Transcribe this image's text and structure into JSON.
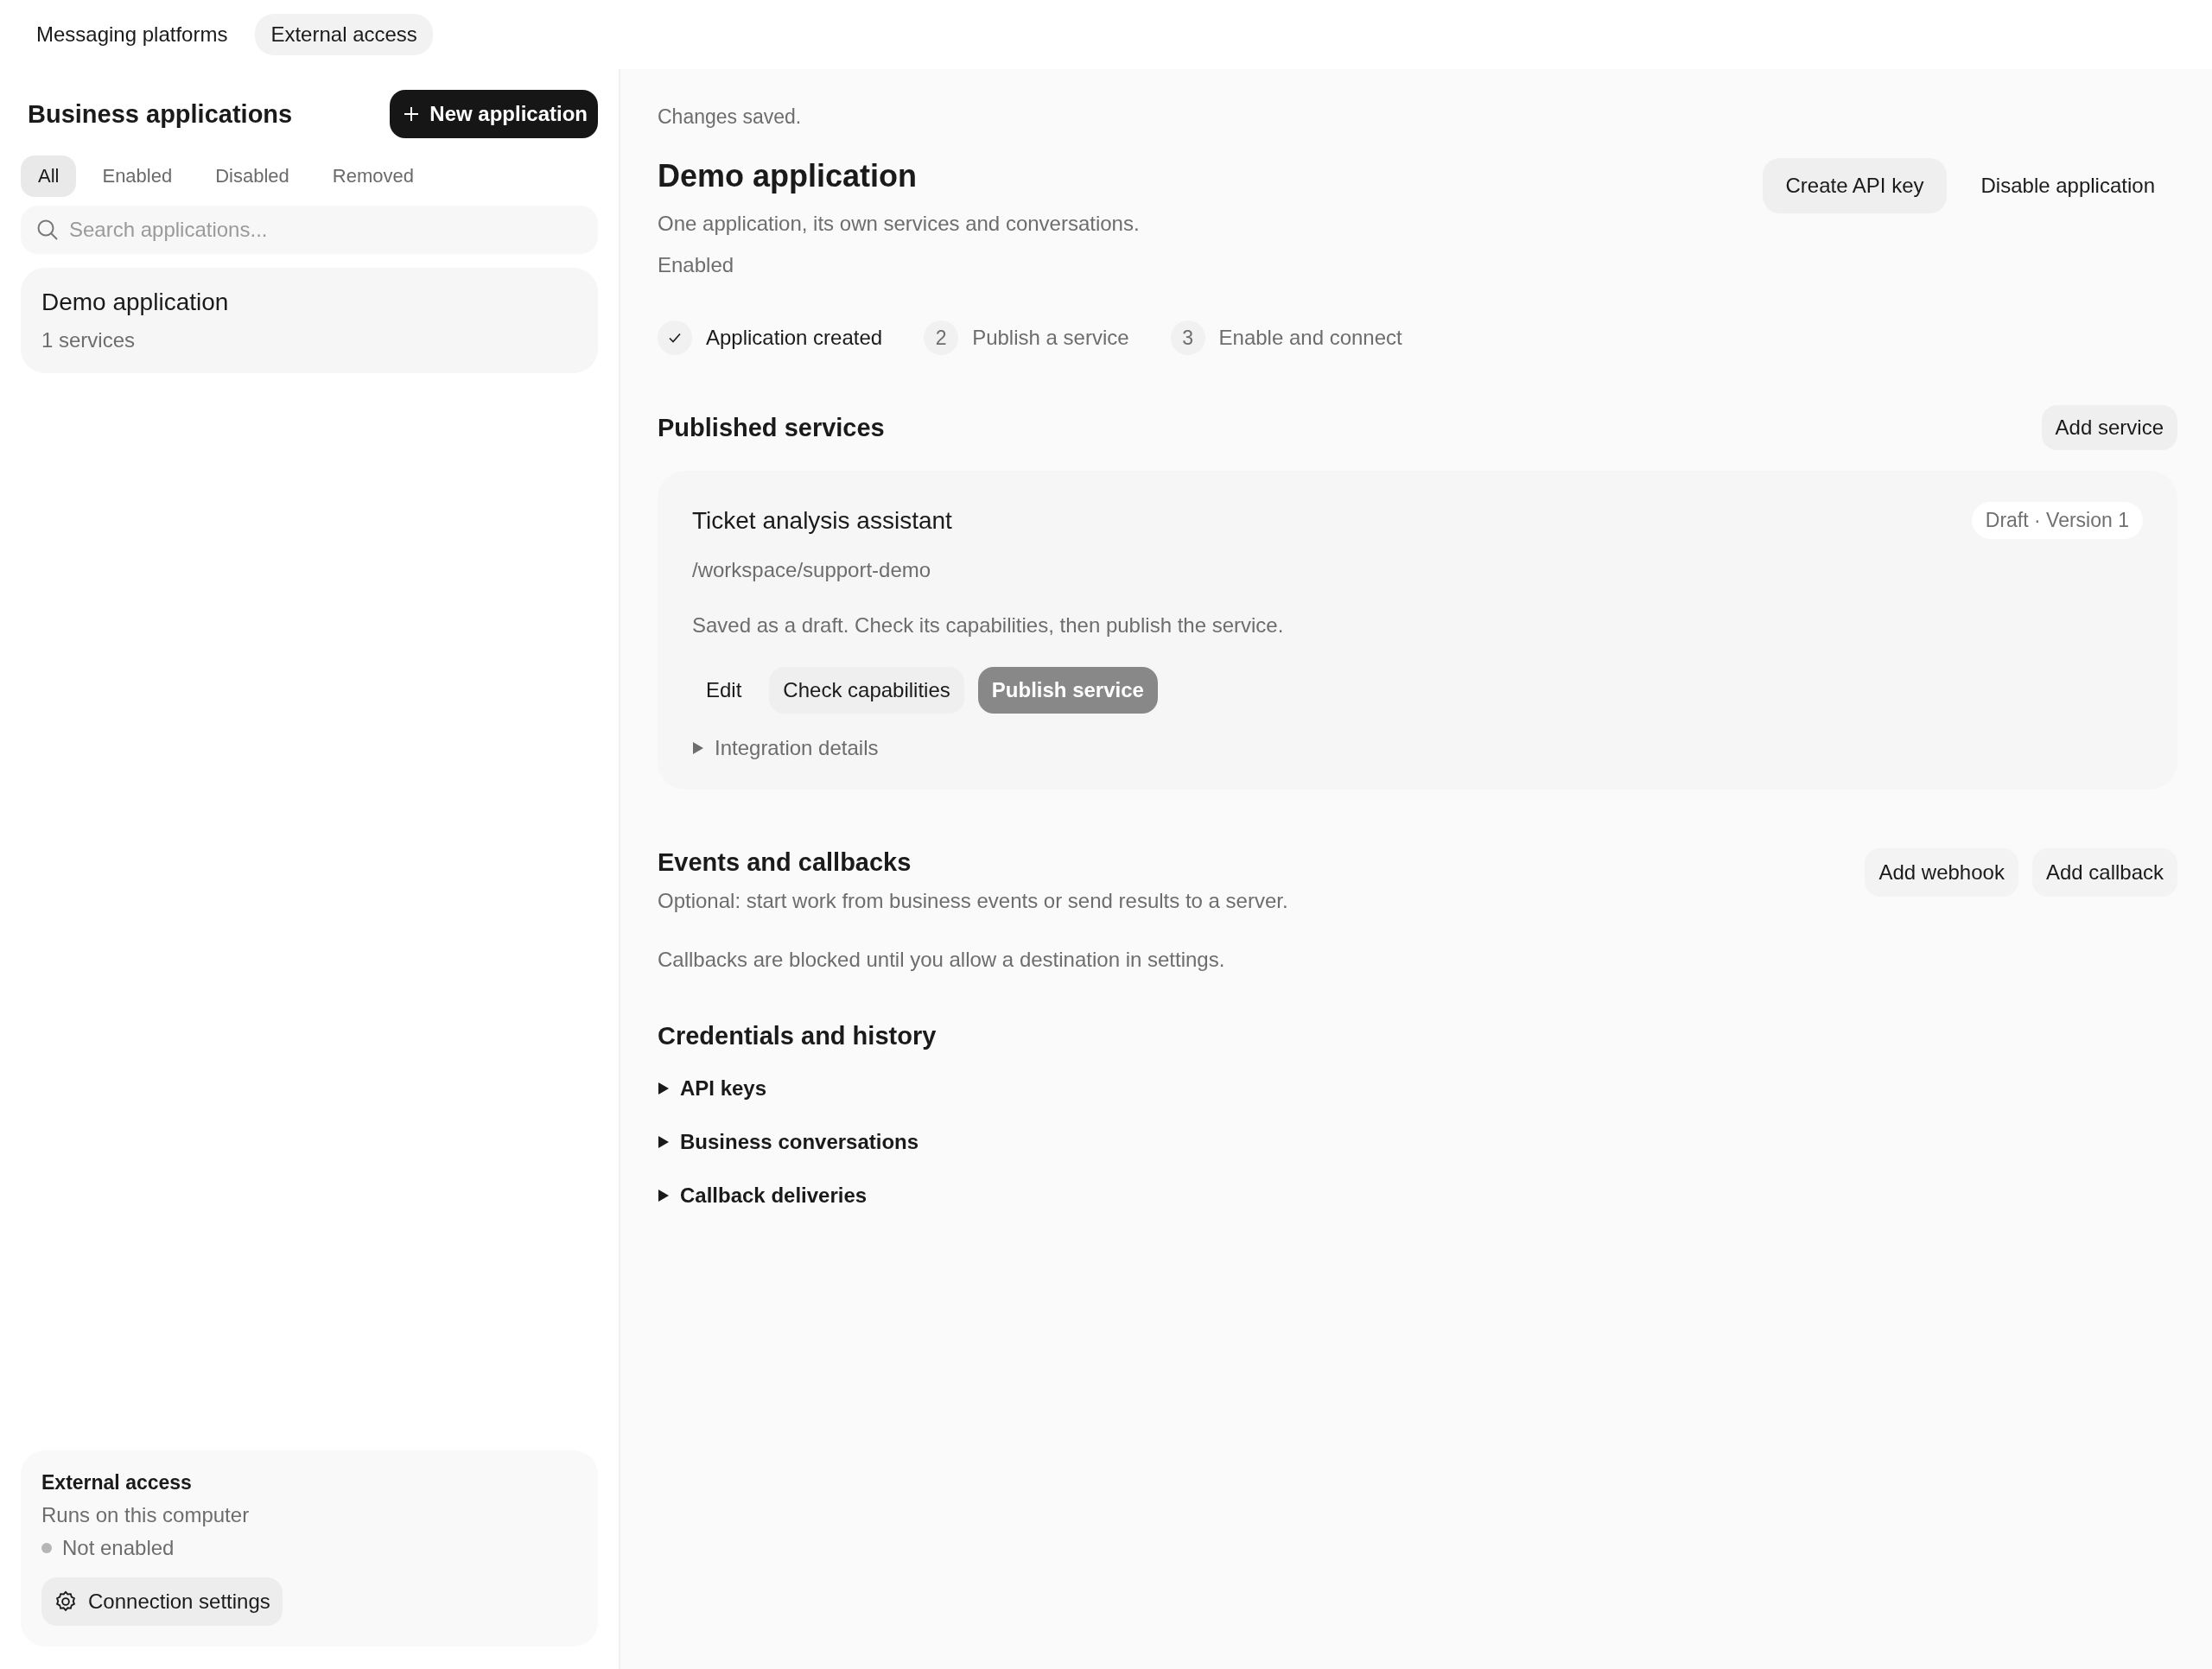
{
  "top_tabs": [
    {
      "label": "Messaging platforms",
      "selected": false
    },
    {
      "label": "External access",
      "selected": true
    }
  ],
  "sidebar": {
    "title": "Business applications",
    "new_button": "New application",
    "filters": [
      {
        "label": "All",
        "selected": true
      },
      {
        "label": "Enabled",
        "selected": false
      },
      {
        "label": "Disabled",
        "selected": false
      },
      {
        "label": "Removed",
        "selected": false
      }
    ],
    "search": {
      "placeholder": "Search applications..."
    },
    "applications": [
      {
        "name": "Demo application",
        "services": "1 services"
      }
    ],
    "footer": {
      "title": "External access",
      "subtitle": "Runs on this computer",
      "status": {
        "label": "Not enabled",
        "color": "#b5b5b5"
      },
      "settings_button": "Connection settings"
    }
  },
  "main": {
    "notice": "Changes saved.",
    "title": "Demo application",
    "description": "One application, its own services and conversations.",
    "status": "Enabled",
    "actions": [
      {
        "label": "Create API key",
        "kind": "tinted"
      },
      {
        "label": "Disable application",
        "kind": "plain"
      }
    ],
    "steps": [
      {
        "label": "Application created",
        "done": true
      },
      {
        "number": "2",
        "label": "Publish a service",
        "done": false
      },
      {
        "number": "3",
        "label": "Enable and connect",
        "done": false
      }
    ],
    "published": {
      "title": "Published services",
      "add_button": "Add service",
      "services": [
        {
          "name": "Ticket analysis assistant",
          "badge": "Draft · Version 1",
          "path": "/workspace/support-demo",
          "message": "Saved as a draft. Check its capabilities, then publish the service.",
          "actions": [
            {
              "label": "Edit",
              "kind": "plain"
            },
            {
              "label": "Check capabilities",
              "kind": "tinted"
            },
            {
              "label": "Publish service",
              "kind": "muted"
            }
          ],
          "details": {
            "label": "Integration details",
            "expanded": false
          }
        }
      ]
    },
    "events": {
      "title": "Events and callbacks",
      "description": "Optional: start work from business events or send results to a server.",
      "note": "Callbacks are blocked until you allow a destination in settings.",
      "actions": [
        {
          "label": "Add webhook",
          "kind": "tinted"
        },
        {
          "label": "Add callback",
          "kind": "tinted"
        }
      ]
    },
    "credentials": {
      "title": "Credentials and history",
      "sections": [
        {
          "label": "API keys",
          "expanded": false
        },
        {
          "label": "Business conversations",
          "expanded": false
        },
        {
          "label": "Callback deliveries",
          "expanded": false
        }
      ]
    }
  }
}
